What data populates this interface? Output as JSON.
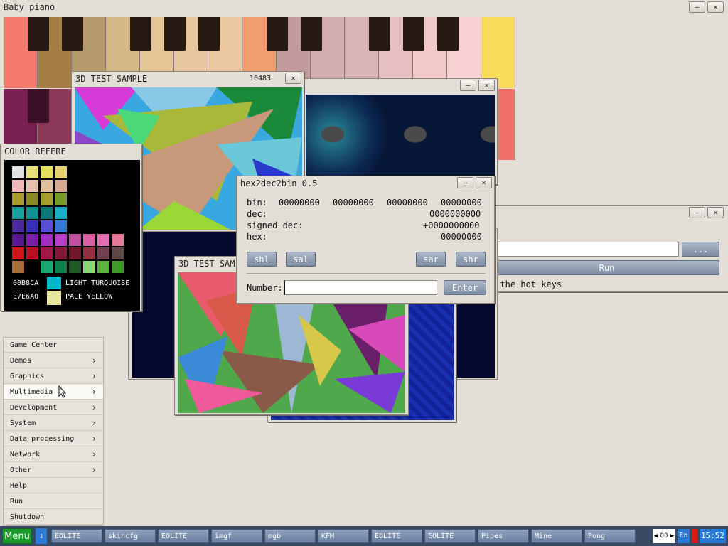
{
  "piano": {
    "title": "Baby piano"
  },
  "test3d_a": {
    "title": "3D TEST SAMPLE",
    "counter": "10483"
  },
  "test3d_b": {
    "title": "3D TEST SAM"
  },
  "color_ref": {
    "title": "COLOR REFERE",
    "entries": [
      {
        "hex": "00B8CA",
        "name": "LIGHT TURQUOISE",
        "color": "#00b8ca"
      },
      {
        "hex": "E7E6A0",
        "name": "PALE YELLOW",
        "color": "#e7e6a0"
      }
    ]
  },
  "hex2dec": {
    "title": "hex2dec2bin 0.5",
    "bin_label": "bin:",
    "bin_groups": [
      "00000000",
      "00000000",
      "00000000",
      "00000000"
    ],
    "dec_label": "dec:",
    "dec_value": "0000000000",
    "sdec_label": "signed dec:",
    "sdec_value": "+0000000000",
    "hex_label": "hex:",
    "hex_value": "00000000",
    "buttons": {
      "shl": "shl",
      "sal": "sal",
      "sar": "sar",
      "shr": "shr"
    },
    "number_label": "Number:",
    "number_value": "",
    "enter": "Enter"
  },
  "run_dialog": {
    "browse": "...",
    "run": "Run",
    "hint": "t the hot keys"
  },
  "main_menu": {
    "items": [
      {
        "label": "Game Center",
        "sub": false
      },
      {
        "label": "Demos",
        "sub": true
      },
      {
        "label": "Graphics",
        "sub": true
      },
      {
        "label": "Multimedia",
        "sub": true
      },
      {
        "label": "Development",
        "sub": true
      },
      {
        "label": "System",
        "sub": true
      },
      {
        "label": "Data processing",
        "sub": true
      },
      {
        "label": "Network",
        "sub": true
      },
      {
        "label": "Other",
        "sub": true
      },
      {
        "label": "Help",
        "sub": false
      },
      {
        "label": "Run",
        "sub": false
      },
      {
        "label": "Shutdown",
        "sub": false
      }
    ]
  },
  "taskbar": {
    "menu_label": "Menu",
    "apps": [
      "EOLITE",
      "skincfg",
      "EOLITE",
      "imgf",
      "mgb",
      "KFM",
      "EOLITE",
      "EOLITE",
      "Pipes",
      "Mine",
      "Pong"
    ],
    "page": "00",
    "lang": "En",
    "clock": "15:52"
  }
}
